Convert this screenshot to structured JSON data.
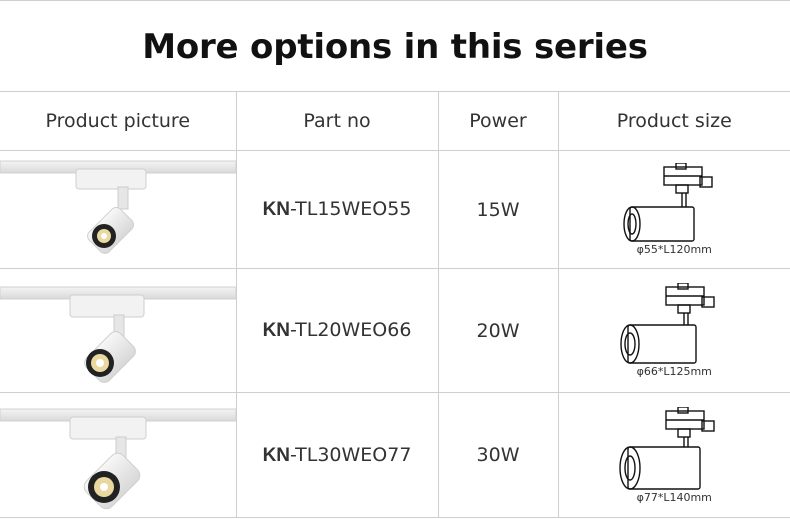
{
  "title": "More options in this series",
  "table": {
    "headers": [
      "Product picture",
      "Part no",
      "Power",
      "Product size"
    ],
    "rows": [
      {
        "part_prefix": "KN",
        "part_suffix": "-TL15WEO55",
        "power": "15W",
        "size": "φ55*L120mm"
      },
      {
        "part_prefix": "KN",
        "part_suffix": "-TL20WEO66",
        "power": "20W",
        "size": "φ66*L125mm"
      },
      {
        "part_prefix": "KN",
        "part_suffix": "-TL30WEO77",
        "power": "30W",
        "size": "φ77*L140mm"
      }
    ]
  },
  "icons": {
    "product_picture": "track-spotlight-photo",
    "product_size": "track-spotlight-line-drawing"
  }
}
